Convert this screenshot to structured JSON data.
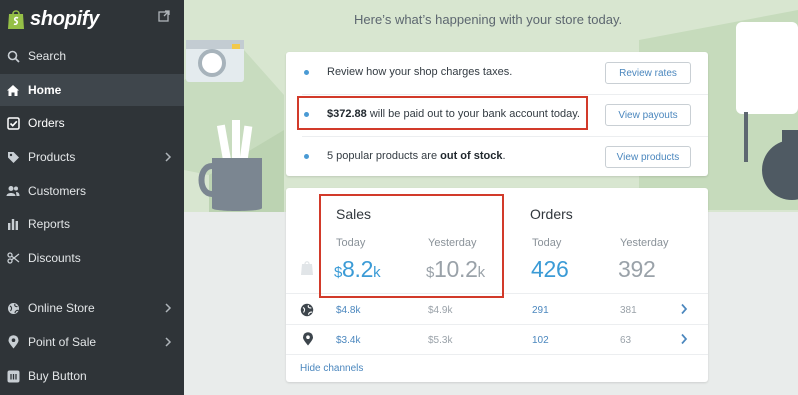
{
  "brand": {
    "name": "shopify"
  },
  "sidebar": {
    "items": [
      {
        "label": "Search",
        "icon": "search-icon"
      },
      {
        "label": "Home",
        "icon": "home-icon",
        "active": true
      },
      {
        "label": "Orders",
        "icon": "orders-icon"
      },
      {
        "label": "Products",
        "icon": "tag-icon"
      },
      {
        "label": "Customers",
        "icon": "customers-icon"
      },
      {
        "label": "Reports",
        "icon": "reports-icon"
      },
      {
        "label": "Discounts",
        "icon": "discounts-icon"
      },
      {
        "label": "Online Store",
        "icon": "online-store-icon"
      },
      {
        "label": "Point of Sale",
        "icon": "location-pin-icon"
      },
      {
        "label": "Buy Button",
        "icon": "buy-button-icon"
      }
    ]
  },
  "main": {
    "headline": "Here’s what’s happening with your store today.",
    "tasks": [
      {
        "text": "Review how your shop charges taxes.",
        "button": "Review rates"
      },
      {
        "strong": "$372.88",
        "text_after": " will be paid out to your bank account today.",
        "button": "View payouts"
      },
      {
        "text_before": "5 popular products are ",
        "strong": "out of stock",
        "text_after": ".",
        "button": "View products"
      }
    ],
    "sales": {
      "title": "Sales",
      "today_label": "Today",
      "yesterday_label": "Yesterday",
      "today_prefix": "$",
      "today_number": "8.2",
      "today_suffix": "k",
      "yesterday_prefix": "$",
      "yesterday_number": "10.2",
      "yesterday_suffix": "k"
    },
    "orders": {
      "title": "Orders",
      "today_label": "Today",
      "yesterday_label": "Yesterday",
      "today": "426",
      "yesterday": "392"
    },
    "channels": [
      {
        "icon": "globe-icon",
        "sales_today": "$4.8k",
        "sales_yesterday": "$4.9k",
        "orders_today": "291",
        "orders_yesterday": "381"
      },
      {
        "icon": "location-pin-icon",
        "sales_today": "$3.4k",
        "sales_yesterday": "$5.3k",
        "orders_today": "102",
        "orders_yesterday": "63"
      }
    ],
    "hide_channels": "Hide channels"
  },
  "colors": {
    "sidebar": "#2f3438",
    "accent": "#3b9bd6",
    "highlight": "#d23a2a",
    "background": "#d8e6d0"
  }
}
